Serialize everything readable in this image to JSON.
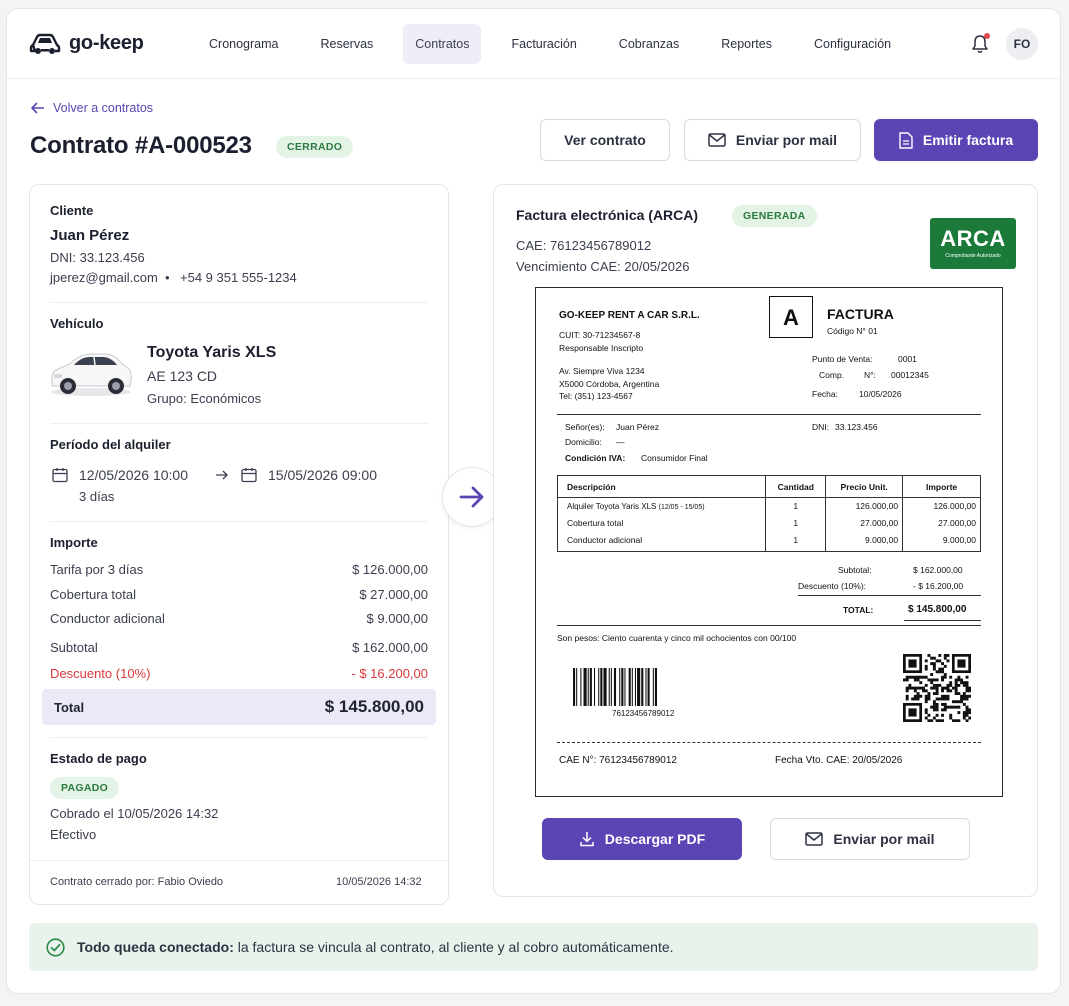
{
  "nav": {
    "brand": "go-keep",
    "items": [
      "Cronograma",
      "Reservas",
      "Contratos",
      "Facturación",
      "Cobranzas",
      "Reportes",
      "Configuración"
    ],
    "active": "Contratos",
    "avatar": "FO"
  },
  "header": {
    "back": "Volver a contratos",
    "title": "Contrato #A-000523",
    "status": "CERRADO",
    "btn_view": "Ver contrato",
    "btn_mail": "Enviar por mail",
    "btn_invoice": "Emitir factura"
  },
  "client": {
    "heading": "Cliente",
    "name": "Juan Pérez",
    "dni": "DNI: 33.123.456",
    "email": "jperez@gmail.com",
    "sep": "•",
    "phone": "+54 9 351 555-1234"
  },
  "vehicle": {
    "heading": "Vehículo",
    "model": "Toyota Yaris XLS",
    "plate": "AE 123 CD",
    "group": "Grupo: Económicos"
  },
  "period": {
    "heading": "Período del alquiler",
    "start": "12/05/2026 10:00",
    "end": "15/05/2026 09:00",
    "duration": "3 días"
  },
  "amount": {
    "heading": "Importe",
    "lines": [
      {
        "label": "Tarifa por 3 días",
        "value": "$ 126.000,00"
      },
      {
        "label": "Cobertura total",
        "value": "$ 27.000,00"
      },
      {
        "label": "Conductor adicional",
        "value": "$ 9.000,00"
      }
    ],
    "subtotal_label": "Subtotal",
    "subtotal": "$ 162.000,00",
    "discount_label": "Descuento (10%)",
    "discount": "- $ 16.200,00",
    "total_label": "Total",
    "total": "$ 145.800,00"
  },
  "payment": {
    "heading": "Estado de pago",
    "status": "PAGADO",
    "collected": "Cobrado el 10/05/2026 14:32",
    "method": "Efectivo",
    "closed_by_label": "Contrato cerrado por:",
    "closed_by": "Fabio Oviedo",
    "closed_at": "10/05/2026 14:32"
  },
  "einvoice": {
    "heading": "Factura electrónica (ARCA)",
    "status": "GENERADA",
    "cae": "CAE: 76123456789012",
    "cae_exp": "Vencimiento CAE: 20/05/2026",
    "arca_logo": "ARCA",
    "arca_sub": "Comprobante Autorizado",
    "btn_download": "Descargar PDF",
    "btn_mail": "Enviar por mail"
  },
  "invoice": {
    "company": "GO-KEEP RENT A CAR S.R.L.",
    "cuit": "CUIT: 30-71234567-8",
    "iva": "Responsable Inscripto",
    "addr1": "Av. Siempre Viva 1234",
    "addr2": "X5000 Córdoba, Argentina",
    "tel": "Tel: (351) 123-4567",
    "letter": "A",
    "doc": "FACTURA",
    "code": "Código N° 01",
    "pv_label": "Punto de Venta:",
    "pv": "0001",
    "comp_label": "Comp.",
    "num_label": "N°:",
    "num": "00012345",
    "date_label": "Fecha:",
    "date": "10/05/2026",
    "client_label": "Señor(es):",
    "client": "Juan Pérez",
    "dni_label": "DNI:",
    "dni": "33.123.456",
    "domicile_label": "Domicilio:",
    "domicile": "—",
    "ivacond_label": "Condición IVA:",
    "ivacond": "Consumidor Final",
    "columns": [
      "Descripción",
      "Cantidad",
      "Precio Unit.",
      "Importe"
    ],
    "rows": [
      {
        "desc": "Alquiler Toyota Yaris XLS",
        "desc_extra": "(12/05 - 15/05)",
        "qty": "1",
        "unit": "126.000,00",
        "amount": "126.000,00"
      },
      {
        "desc": "Cobertura total",
        "desc_extra": "",
        "qty": "1",
        "unit": "27.000,00",
        "amount": "27.000,00"
      },
      {
        "desc": "Conductor adicional",
        "desc_extra": "",
        "qty": "1",
        "unit": "9.000,00",
        "amount": "9.000,00"
      }
    ],
    "subtotal_label": "Subtotal:",
    "subtotal": "$ 162.000,00",
    "discount_label": "Descuento (10%):",
    "discount": "- $ 16.200,00",
    "total_label": "TOTAL:",
    "total": "$ 145.800,00",
    "words": "Son pesos: Ciento cuarenta y cinco mil ochocientos con 00/100",
    "barcode": "76123456789012",
    "cae_label": "CAE N°:",
    "cae": "76123456789012",
    "vto_label": "Fecha Vto. CAE:",
    "vto": "20/05/2026"
  },
  "notice": {
    "bold": "Todo queda conectado:",
    "text": " la factura se vincula al contrato, al cliente y al cobro automáticamente."
  },
  "colors": {
    "primary": "#5b45b5",
    "success_bg": "#e3f3e6",
    "success": "#2b7a3f",
    "danger": "#d9383c",
    "arca": "#1b7a3a"
  }
}
